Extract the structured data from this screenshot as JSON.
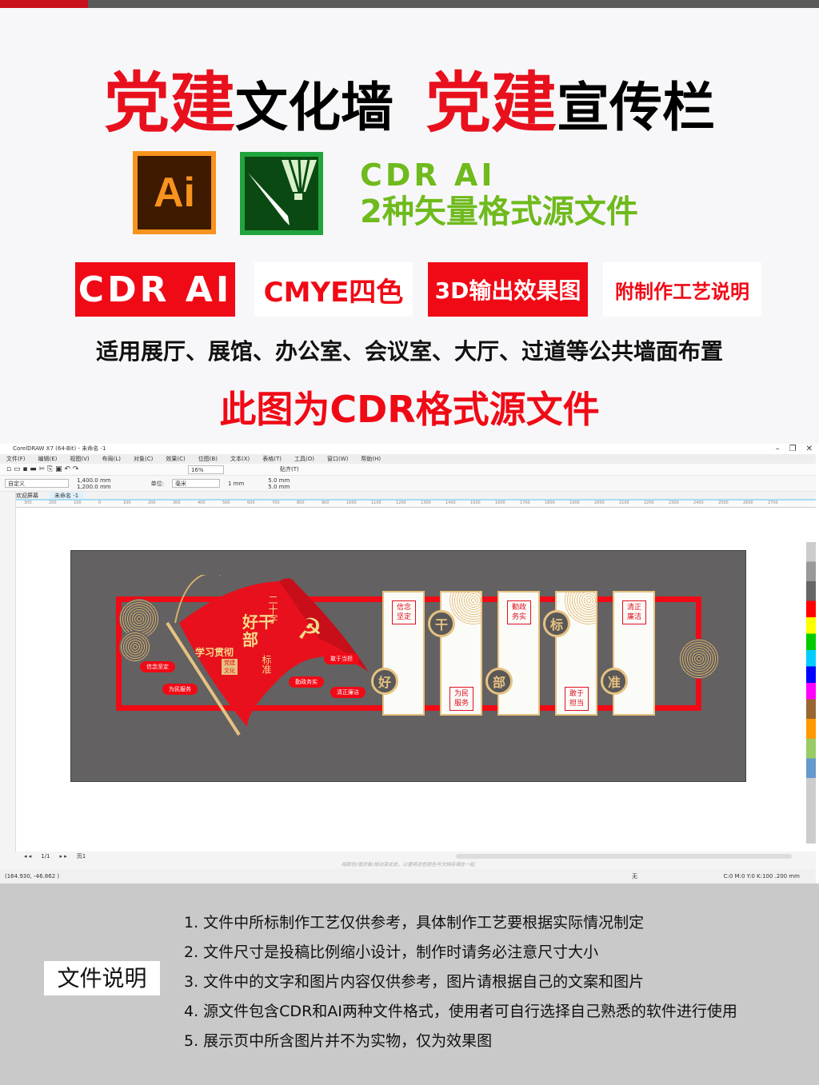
{
  "header": {
    "title": [
      {
        "text": "党建",
        "color": "#e8101c"
      },
      {
        "text": "文化墙",
        "color": "#000000"
      },
      {
        "text": "党建",
        "color": "#e8101c"
      },
      {
        "text": "宣传栏",
        "color": "#000000"
      }
    ],
    "logos": {
      "ai": "Ai",
      "cdr": "coreldraw-icon"
    },
    "formats_line1": "CDR AI",
    "formats_line2": "2种矢量格式源文件",
    "tags": [
      "CDR AI",
      "CMYE四色",
      "3D输出效果图",
      "附制作工艺说明"
    ],
    "usage": "适用展厅、展馆、办公室、会议室、大厅、过道等公共墙面布置",
    "note": "此图为CDR格式源文件"
  },
  "corel": {
    "title": "CorelDRAW X7 (64-Bit) - 未命名 -1",
    "menu": [
      "文件(F)",
      "编辑(E)",
      "视图(V)",
      "布局(L)",
      "对象(C)",
      "效果(C)",
      "位图(B)",
      "文本(X)",
      "表格(T)",
      "工具(O)",
      "窗口(W)",
      "帮助(H)"
    ],
    "zoom": "16%",
    "snap": "贴齐(T)",
    "preset": "自定义",
    "width": "1,400.0 mm",
    "height": "1,200.0 mm",
    "unit_label": "单位:",
    "unit": "毫米",
    "nudge": "1 mm",
    "dup_x": "5.0 mm",
    "dup_y": "5.0 mm",
    "tabs": [
      "欢迎屏幕",
      "未命名 -1"
    ],
    "ruler": [
      "300",
      "200",
      "100",
      "0",
      "100",
      "200",
      "300",
      "400",
      "500",
      "600",
      "700",
      "800",
      "900",
      "1000",
      "1100",
      "1200",
      "1300",
      "1400",
      "1500",
      "1600",
      "1700",
      "1800",
      "1900",
      "2000",
      "2100",
      "2200",
      "2300",
      "2400",
      "2500",
      "2600",
      "2700"
    ],
    "page_nav": "1/1",
    "page_tab": "页1",
    "hint": "将颜色(或对象)拖动至此处，以便将这些颜色与文档存储在一起",
    "coords": "(164.930, -46.862 )",
    "fill_status": "无",
    "outline_status": "C:0 M:0 Y:0 K:100 .200 mm",
    "colors": {
      "accent": "#f00a16",
      "gold": "#e6c281",
      "wall": "#636162"
    }
  },
  "wall": {
    "flag_title_vertical": "二十字",
    "flag_big": "好干部",
    "flag_sub": "标准",
    "study": "学习贯彻",
    "badge": "党建文化",
    "pills": [
      "信念坚定",
      "为民服务",
      "敢于当担",
      "勤政务实",
      "清正廉洁"
    ],
    "panels": [
      {
        "seal": "信念坚定",
        "circle": "好"
      },
      {
        "seal": "为民服务",
        "circle": "干"
      },
      {
        "seal": "勤政务实",
        "circle": "部"
      },
      {
        "seal": "敢于担当",
        "circle": "标"
      },
      {
        "seal": "清正廉洁",
        "circle": "准"
      }
    ]
  },
  "footer": {
    "label": "文件说明",
    "notes": [
      "1. 文件中所标制作工艺仅供参考，具体制作工艺要根据实际情况制定",
      "2. 文件尺寸是投稿比例缩小设计，制作时请务必注意尺寸大小",
      "3. 文件中的文字和图片内容仅供参考，图片请根据自己的文案和图片",
      "4. 源文件包含CDR和AI两种文件格式，使用者可自行选择自己熟悉的软件进行使用",
      "5. 展示页中所含图片并不为实物，仅为效果图"
    ]
  }
}
